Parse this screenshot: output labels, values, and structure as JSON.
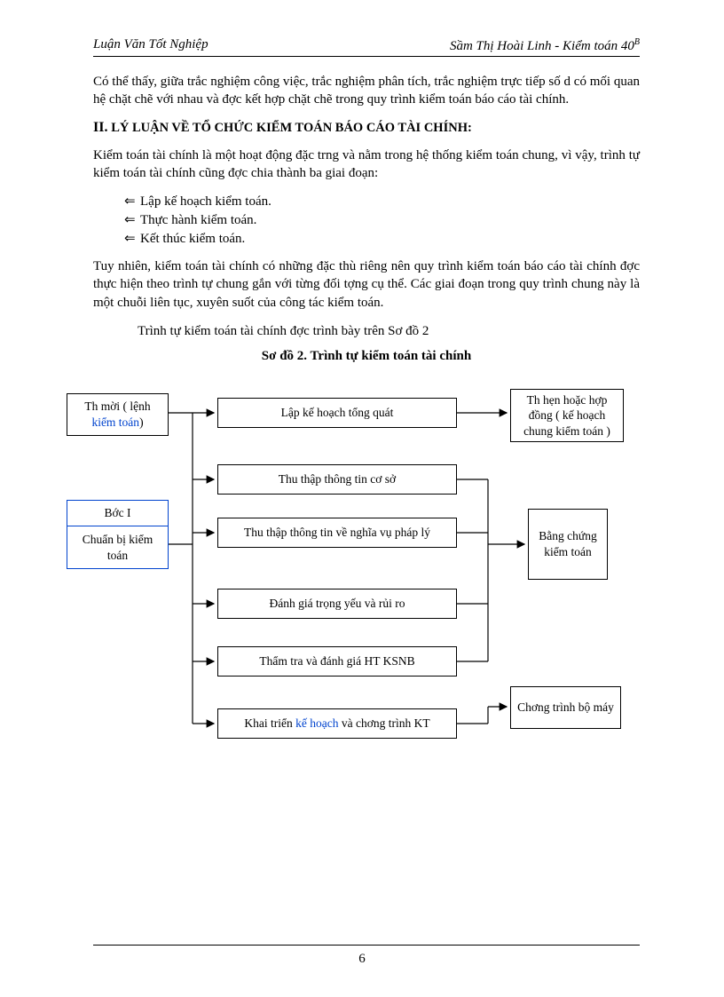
{
  "header": {
    "left": "Luận Văn Tốt Nghiệp",
    "right_prefix": "Sầm Thị Hoài Linh - Kiểm toán 40",
    "right_sup": "B"
  },
  "p1": "Có thể thấy, giữa trắc nghiệm công việc, trắc nghiệm phân tích, trắc nghiệm trực tiếp số d  có mối quan hệ chặt chẽ với nhau và đợc  kết hợp chặt chẽ trong quy trình kiểm toán báo cáo tài chính.",
  "heading": {
    "num": "II.",
    "text": "LÝ LUẬN VỀ TỔ CHỨC KIỂM TOÁN BÁO CÁO TÀI CHÍNH:"
  },
  "p2": "Kiểm toán tài chính là một hoạt động đặc trng  và nằm trong hệ thống kiểm toán chung, vì vậy, trình tự kiểm toán tài chính cũng đợc  chia thành ba giai đoạn:",
  "bullets": [
    "Lập kế hoạch kiểm toán.",
    "Thực hành kiểm toán.",
    "Kết thúc kiểm toán."
  ],
  "p3": "Tuy nhiên, kiểm toán tài chính có những đặc thù riêng nên quy trình kiểm toán báo cáo tài chính đợc  thực hiện theo trình tự chung gắn với từng đối tợng  cụ thể. Các giai đoạn trong quy trình chung này là một chuỗi liên tục, xuyên suốt của công tác kiểm toán.",
  "p4": "Trình tự kiểm toán tài chính đợc  trình bày trên Sơ đồ 2",
  "diagram_title": "Sơ đồ 2. Trình tự kiểm toán tài chính",
  "diagram": {
    "left1_a": "Th  mời ( lệnh ",
    "left1_b": "kiểm toán",
    "left1_c": ")",
    "buoc_top": "Bớc  I",
    "buoc_bot": "Chuẩn bị kiểm toán",
    "mid1": "Lập kế hoạch tổng quát",
    "mid2": "Thu thập thông tin  cơ sở",
    "mid3": "Thu thập thông tin về nghĩa vụ pháp lý",
    "mid4": "Đánh giá trọng yếu và rủi ro",
    "mid5": "Thẩm tra và đánh giá HT KSNB",
    "mid6_a": "Khai triển ",
    "mid6_b": "kế hoạch",
    "mid6_c": " và chơng  trình KT",
    "right1": "Th  hẹn hoặc hợp đồng ( kế hoạch chung kiểm toán  )",
    "right2": "Bằng chứng kiểm toán",
    "right3": "Chơng  trình bộ máy"
  },
  "page_number": "6"
}
